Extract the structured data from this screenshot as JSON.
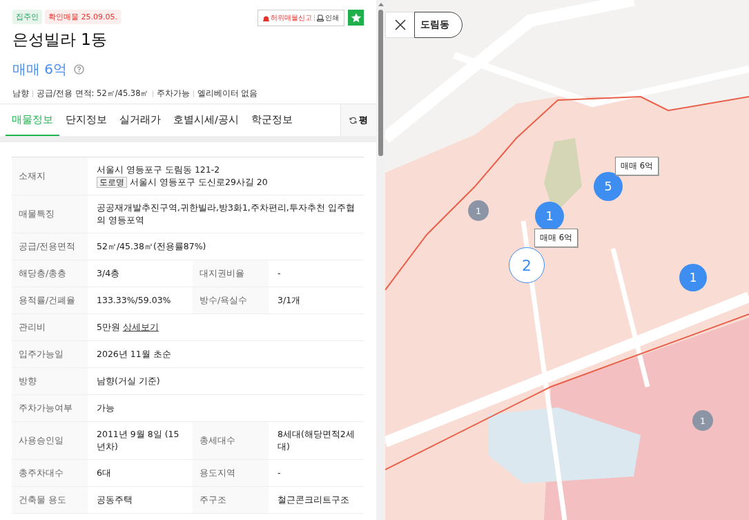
{
  "listing": {
    "tags": [
      {
        "text": "집주인",
        "kind": "owner"
      },
      {
        "text": "확인매물 25.09.05.",
        "kind": "verified"
      }
    ],
    "report_button": "허위매물신고",
    "print_button": "인쇄",
    "favorite": true,
    "title": "은성빌라 1동",
    "price": "매매 6억",
    "summary": [
      "남향",
      "공급/전용 면적: 52㎡/45.38㎡",
      "주차가능",
      "엘리베이터 없음"
    ]
  },
  "tabs": [
    {
      "label": "매물정보",
      "selected": true
    },
    {
      "label": "단지정보",
      "selected": false
    },
    {
      "label": "실거래가",
      "selected": false
    },
    {
      "label": "호별시세/공시",
      "selected": false
    },
    {
      "label": "학군정보",
      "selected": false
    }
  ],
  "unit_button": "평",
  "table": {
    "rows": [
      {
        "cells": [
          {
            "label": "소재지",
            "value": "서울시 영등포구 도림동 121-2",
            "road_badge": "도로명",
            "road_address": "서울시 영등포구 도신로29사길 20"
          }
        ]
      },
      {
        "cells": [
          {
            "label": "매물특징",
            "value": "공공재개발추진구역,귀한빌라,방3화1,주차편리,투자추천 입주협의 영등포역"
          }
        ]
      },
      {
        "cells": [
          {
            "label": "공급/전용면적",
            "value": "52㎡/45.38㎡(전용률87%)"
          }
        ]
      },
      {
        "cells": [
          {
            "label": "해당층/총층",
            "value": "3/4층"
          },
          {
            "label": "대지권비율",
            "value": "-"
          }
        ]
      },
      {
        "cells": [
          {
            "label": "용적률/건폐율",
            "value": "133.33%/59.03%"
          },
          {
            "label": "방수/욕실수",
            "value": "3/1개"
          }
        ]
      },
      {
        "cells": [
          {
            "label": "관리비",
            "value": "5만원",
            "link": "상세보기"
          }
        ]
      },
      {
        "cells": [
          {
            "label": "입주가능일",
            "value": "2026년 11월 초순"
          }
        ]
      },
      {
        "cells": [
          {
            "label": "방향",
            "value": "남향(거실 기준)"
          }
        ]
      },
      {
        "cells": [
          {
            "label": "주차가능여부",
            "value": "가능"
          }
        ]
      },
      {
        "cells": [
          {
            "label": "사용승인일",
            "value": "2011년 9월 8일 (15년차)"
          },
          {
            "label": "총세대수",
            "value": "8세대(해당면적2세대)"
          }
        ]
      },
      {
        "cells": [
          {
            "label": "총주차대수",
            "value": "6대"
          },
          {
            "label": "용도지역",
            "value": "-"
          }
        ]
      },
      {
        "cells": [
          {
            "label": "건축물 용도",
            "value": "공동주택"
          },
          {
            "label": "주구조",
            "value": "철근콘크리트구조"
          }
        ]
      }
    ]
  },
  "map": {
    "kind": "picture",
    "search_chip": "도림동",
    "clusters": [
      {
        "count": "1",
        "kind": "grey"
      },
      {
        "count": "1",
        "kind": "blue"
      },
      {
        "count": "5",
        "kind": "blue"
      },
      {
        "count": "2",
        "kind": "outline"
      },
      {
        "count": "1",
        "kind": "blue"
      },
      {
        "count": "1",
        "kind": "grey"
      }
    ],
    "price_tags": [
      "매매 6억",
      "매매 6억"
    ]
  }
}
